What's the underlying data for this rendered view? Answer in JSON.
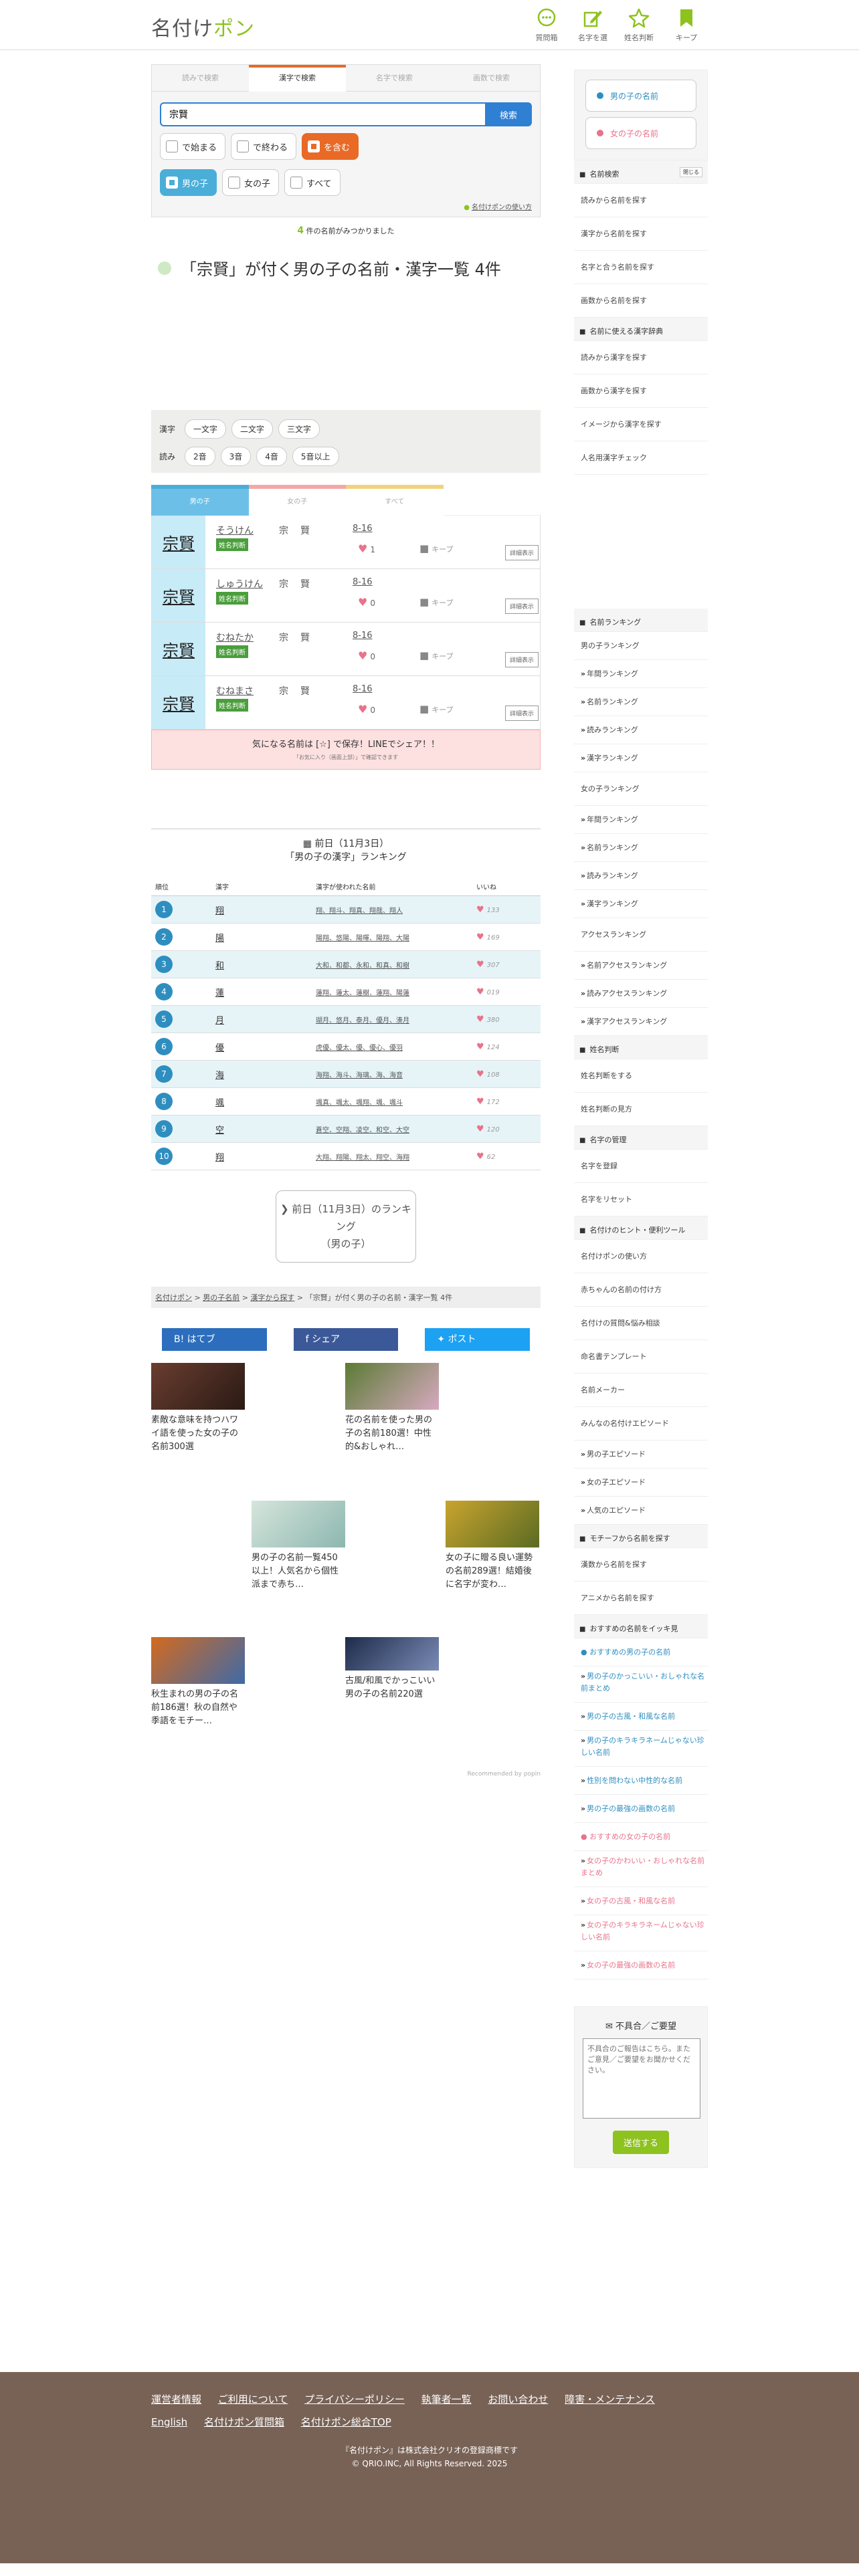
{
  "header": {
    "logo_main": "名付け",
    "logo_accent": "ポン",
    "nav": [
      {
        "label": "質問箱",
        "icon": "chat-icon"
      },
      {
        "label": "名字を選",
        "icon": "edit-icon"
      },
      {
        "label": "姓名判断",
        "icon": "star-icon"
      },
      {
        "label": "キープ",
        "icon": "bookmark-icon"
      }
    ]
  },
  "search": {
    "tabs": [
      "読みで検索",
      "漢字で検索",
      "名字で検索",
      "画数で検索"
    ],
    "active_tab": 1,
    "input_value": "宗賢",
    "button": "検索",
    "match_options": [
      {
        "label": "で始まる",
        "selected": false
      },
      {
        "label": "で終わる",
        "selected": false
      },
      {
        "label": "を含む",
        "selected": true
      }
    ],
    "gender_options": [
      {
        "label": "男の子",
        "selected": true
      },
      {
        "label": "女の子",
        "selected": false
      },
      {
        "label": "すべて",
        "selected": false
      }
    ],
    "howto": "名付けポンの使い方"
  },
  "result": {
    "count": "4",
    "count_suffix": "件の名前がみつかりました",
    "title": "「宗賢」が付く男の子の名前・漢字一覧 4件"
  },
  "filter": {
    "kanji_label": "漢字",
    "kanji_options": [
      "一文字",
      "二文字",
      "三文字"
    ],
    "yomi_label": "読み",
    "yomi_options": [
      "2音",
      "3音",
      "4音",
      "5音以上"
    ]
  },
  "gender_tabs": [
    "男の子",
    "女の子",
    "すべて"
  ],
  "names": [
    {
      "kanji": "宗賢",
      "reading": "そうけん",
      "tag": "姓名判断",
      "chars": "宗賢",
      "strokes": "8-16",
      "likes": "1",
      "keep": "キープ",
      "detail": "詳細表示"
    },
    {
      "kanji": "宗賢",
      "reading": "しゅうけん",
      "tag": "姓名判断",
      "chars": "宗賢",
      "strokes": "8-16",
      "likes": "0",
      "keep": "キープ",
      "detail": "詳細表示"
    },
    {
      "kanji": "宗賢",
      "reading": "むねたか",
      "tag": "姓名判断",
      "chars": "宗賢",
      "strokes": "8-16",
      "likes": "0",
      "keep": "キープ",
      "detail": "詳細表示"
    },
    {
      "kanji": "宗賢",
      "reading": "むねまさ",
      "tag": "姓名判断",
      "chars": "宗賢",
      "strokes": "8-16",
      "likes": "0",
      "keep": "キープ",
      "detail": "詳細表示"
    }
  ],
  "line_bar": {
    "text": "気になる名前は [☆] で保存！LINEでシェア！！",
    "note": "「お気に入り（画面上部）」で確認できます"
  },
  "ranking": {
    "heading": "前日（11月3日）",
    "subheading": "「男の子の漢字」ランキング",
    "columns": [
      "順位",
      "漢字",
      "漢字が使われた名前",
      "いいね"
    ],
    "rows": [
      {
        "rank": "1",
        "kanji": "翔",
        "names": "翔、翔斗、翔真、翔哉、翔人",
        "likes": "133"
      },
      {
        "rank": "2",
        "kanji": "陽",
        "names": "陽翔、悠陽、陽暉、陽翔、大陽",
        "likes": "169"
      },
      {
        "rank": "3",
        "kanji": "和",
        "names": "大和、和都、永和、和真、和樹",
        "likes": "307"
      },
      {
        "rank": "4",
        "kanji": "蓮",
        "names": "蓮翔、蓮太、蓮樹、蓮翔、陽蓮",
        "likes": "019"
      },
      {
        "rank": "5",
        "kanji": "月",
        "names": "瑚月、悠月、泰月、優月、湊月",
        "likes": "380"
      },
      {
        "rank": "6",
        "kanji": "優",
        "names": "虎優、優太、優、優心、優羽",
        "likes": "124"
      },
      {
        "rank": "7",
        "kanji": "海",
        "names": "海翔、海斗、海璃、海、海音",
        "likes": "108"
      },
      {
        "rank": "8",
        "kanji": "颯",
        "names": "颯真、颯太、颯翔、颯、颯斗",
        "likes": "172"
      },
      {
        "rank": "9",
        "kanji": "空",
        "names": "蒼空、空翔、凌空、和空、大空",
        "likes": "120"
      },
      {
        "rank": "10",
        "kanji": "翔",
        "names": "大翔、翔陽、翔太、翔空、海翔",
        "likes": "62"
      }
    ],
    "prev_button": "前日（11月3日）のランキング",
    "prev_button_sub": "（男の子）"
  },
  "breadcrumb": [
    "名付けポン",
    "男の子名前",
    "漢字から探す",
    "「宗賢」が付く男の子の名前・漢字一覧 4件"
  ],
  "share": [
    {
      "label": "はてブ",
      "color": "#2c6ebd"
    },
    {
      "label": "シェア",
      "color": "#3b5998"
    },
    {
      "label": "ポスト",
      "color": "#1da1f2"
    }
  ],
  "recommend": [
    {
      "title": "素敵な意味を持つハワイ語を使った女の子の名前300選"
    },
    {
      "title": "花の名前を使った男の子の名前180選！中性的&おしゃれ…"
    },
    {
      "title": "男の子の名前一覧450以上！人気名から個性派まで赤ち…"
    },
    {
      "title": "女の子に贈る良い運勢の名前289選！結婚後に名字が変わ…"
    },
    {
      "title": "秋生まれの男の子の名前186選！秋の自然や季語をモチー…"
    },
    {
      "title": "古風/和風でかっこいい男の子の名前220選"
    }
  ],
  "powered": "Recommended by popin",
  "sidebar": {
    "gender_buttons": [
      {
        "label": "男の子の名前",
        "color": "#2e8ec0"
      },
      {
        "label": "女の子の名前",
        "color": "#e8738a"
      }
    ],
    "name_search_head": "名前検索",
    "name_search_toggle": "閉じる",
    "name_search": [
      "読みから名前を探す",
      "漢字から名前を探す",
      "名字と合う名前を探す",
      "画数から名前を探す"
    ],
    "kanji_dict_head": "名前に使える漢字辞典",
    "kanji_dict": [
      "読みから漢字を探す",
      "画数から漢字を探す",
      "イメージから漢字を探す",
      "人名用漢字チェック"
    ],
    "ranking_head": "名前ランキング",
    "ranking_boy": [
      "男の子ランキング",
      "年間ランキング",
      "名前ランキング",
      "読みランキング",
      "漢字ランキング"
    ],
    "ranking_girl": [
      "女の子ランキング",
      "年間ランキング",
      "名前ランキング",
      "読みランキング",
      "漢字ランキング"
    ],
    "ranking_access": [
      "アクセスランキング",
      "名前アクセスランキング",
      "読みアクセスランキング",
      "漢字アクセスランキング"
    ],
    "fortune_head": "姓名判断",
    "fortune": [
      "姓名判断をする",
      "姓名判断の見方"
    ],
    "surname_head": "名字の管理",
    "surname": [
      "名字を登録",
      "名字をリセット"
    ],
    "tools_head": "名付けのヒント・便利ツール",
    "tools": [
      "名付けポンの使い方",
      "赤ちゃんの名前の付け方",
      "名付けの質問&悩み相談",
      "命名書テンプレート",
      "名前メーカー",
      "みんなの名付けエピソード",
      "男の子エピソード",
      "女の子エピソード",
      "人気のエピソード"
    ],
    "motif_head": "モチーフから名前を探す",
    "motif": [
      "漢数から名前を探す",
      "アニメから名前を探す"
    ],
    "pickup_head": "おすすめの名前をイッキ見",
    "pickup_boy_head": "おすすめの男の子の名前",
    "pickup_boy": [
      "男の子のかっこいい・おしゃれな名前まとめ",
      "男の子の古風・和風な名前",
      "男の子のキラキラネームじゃない珍しい名前",
      "性別を問わない中性的な名前",
      "男の子の最強の画数の名前"
    ],
    "pickup_girl_head": "おすすめの女の子の名前",
    "pickup_girl": [
      "女の子のかわいい・おしゃれな名前まとめ",
      "女の子の古風・和風な名前",
      "女の子のキラキラネームじゃない珍しい名前",
      "女の子の最強の画数の名前"
    ],
    "feedback_title": "不具合／ご要望",
    "feedback_placeholder": "不具合のご報告はこちら。また ご意見／ご要望をお聞かせください。",
    "feedback_button": "送信する"
  },
  "footer": {
    "links": [
      "運営者情報",
      "ご利用について",
      "プライバシーポリシー",
      "執筆者一覧",
      "お問い合わせ",
      "障害・メンテナンス",
      "English",
      "名付けポン質問箱",
      "名付けポン総合TOP"
    ],
    "operator": "『名付けポン』は株式会社クリオの登録商標です",
    "copyright": "© QRIO.INC, All Rights Reserved. 2025"
  }
}
